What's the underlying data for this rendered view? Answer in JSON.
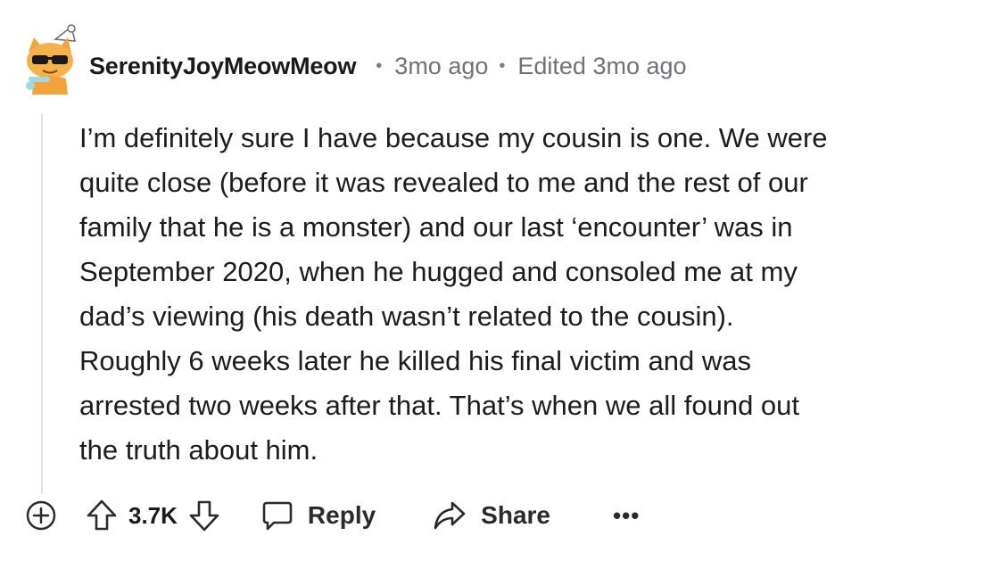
{
  "comment": {
    "author": "SerenityJoyMeowMeow",
    "separator": "•",
    "age": "3mo ago",
    "edited": "Edited 3mo ago",
    "body_lines": [
      "I’m definitely sure I have because my cousin is one. We were",
      "quite close (before it was revealed to me and the rest of our",
      "family that he is a monster) and our last ‘encounter’ was in",
      "September 2020, when he hugged and consoled me at my",
      "dad’s viewing (his death wasn’t related to the cousin).",
      "Roughly 6 weeks later he killed his final victim and was",
      "arrested two weeks after that. That’s when we all found out",
      "the truth about him."
    ]
  },
  "actions": {
    "expand_icon": "plus-circle-icon",
    "upvote_icon": "arrow-up-icon",
    "score": "3.7K",
    "downvote_icon": "arrow-down-icon",
    "reply_icon": "speech-bubble-icon",
    "reply_label": "Reply",
    "share_icon": "share-arrow-icon",
    "share_label": "Share",
    "more_label": "•••"
  },
  "colors": {
    "text": "#1c1c1c",
    "meta": "#6f7377",
    "thread_line": "#dfe3e6",
    "avatar_orange": "#f2a33a",
    "avatar_teal": "#9fd8e6"
  }
}
